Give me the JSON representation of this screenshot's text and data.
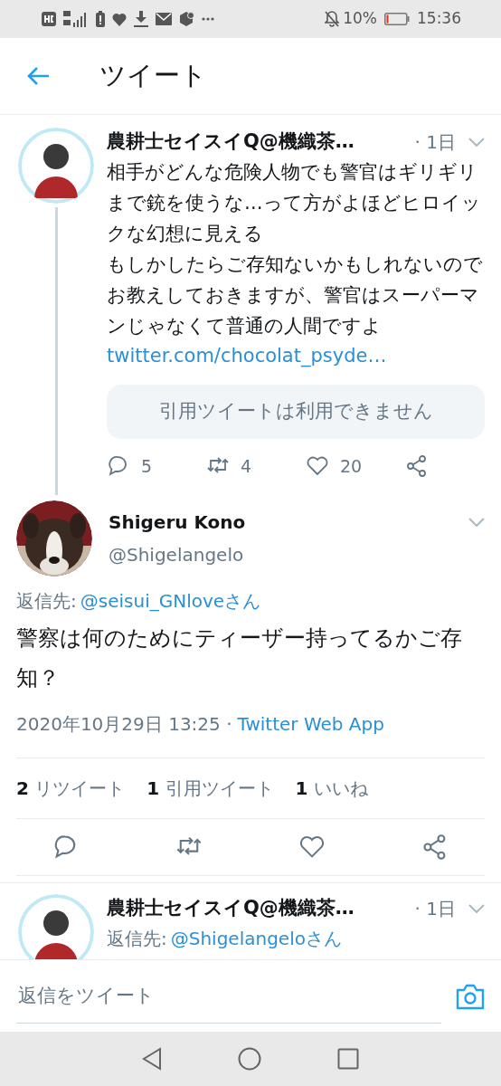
{
  "status_bar": {
    "battery": "10%",
    "time": "15:36"
  },
  "header": {
    "title": "ツイート"
  },
  "parent_tweet": {
    "name": "農耕士セイスイQ@機織茶…",
    "time": "· 1日",
    "paragraphs": [
      "相手がどんな危険人物でも警官はギリギリまで銃を使うな…って方がよほどヒロイックな幻想に見える",
      "もしかしたらご存知ないかもしれないのでお教えしておきますが、警官はスーパーマンじゃなくて普通の人間ですよ"
    ],
    "link": "twitter.com/chocolat_psyde…",
    "quote_notice": "引用ツイートは利用できません",
    "replies": "5",
    "retweets": "4",
    "likes": "20"
  },
  "main_tweet": {
    "name": "Shigeru Kono",
    "handle": "@Shigelangelo",
    "reply_label": "返信先:",
    "reply_to": "@seisui_GNloveさん",
    "text": "警察は何のためにティーザー持ってるかご存知？",
    "timestamp": "2020年10月29日 13:25 ·",
    "source": "Twitter Web App",
    "stats": [
      {
        "count": "2",
        "label": "リツイート"
      },
      {
        "count": "1",
        "label": "引用ツイート"
      },
      {
        "count": "1",
        "label": "いいね"
      }
    ]
  },
  "reply_tweet": {
    "name": "農耕士セイスイQ@機織茶…",
    "time": "· 1日",
    "reply_label": "返信先:",
    "reply_to": "@Shigelangeloさん"
  },
  "composer": {
    "placeholder": "返信をツイート"
  }
}
